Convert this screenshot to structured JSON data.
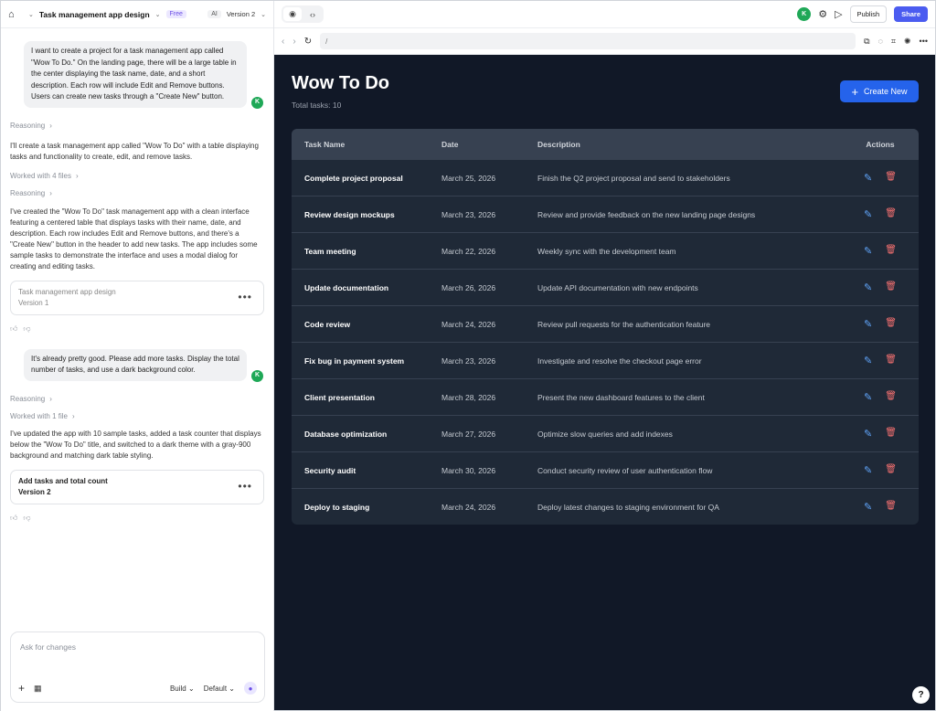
{
  "header": {
    "project_title": "Task management app design",
    "plan_badge": "Free",
    "ai_badge": "AI",
    "version": "Version 2"
  },
  "chat": {
    "messages": [
      {
        "role": "user",
        "text": "I want to create a project for a task management app called \"Wow To Do.\" On the landing page, there will be a large table in the center displaying the task name, date, and a short description. Each row will include Edit and Remove buttons. Users can create new tasks through a \"Create New\" button.",
        "avatar": "K"
      },
      {
        "role": "meta",
        "text": "Reasoning"
      },
      {
        "role": "assistant",
        "text": "I'll create a task management app called \"Wow To Do\" with a table displaying tasks and functionality to create, edit, and remove tasks."
      },
      {
        "role": "meta",
        "text": "Worked with 4 files"
      },
      {
        "role": "meta",
        "text": "Reasoning"
      },
      {
        "role": "assistant",
        "text": "I've created the \"Wow To Do\" task management app with a clean interface featuring a centered table that displays tasks with their name, date, and description. Each row includes Edit and Remove buttons, and there's a \"Create New\" button in the header to add new tasks. The app includes some sample tasks to demonstrate the interface and uses a modal dialog for creating and editing tasks."
      },
      {
        "role": "card",
        "title": "Task management app design",
        "version": "Version 1"
      },
      {
        "role": "user",
        "text": "It's already pretty good. Please add more tasks. Display the total number of tasks, and use a dark background color.",
        "avatar": "K"
      },
      {
        "role": "meta",
        "text": "Reasoning"
      },
      {
        "role": "meta",
        "text": "Worked with 1 file"
      },
      {
        "role": "assistant",
        "text": "I've updated the app with 10 sample tasks, added a task counter that displays below the \"Wow To Do\" title, and switched to a dark theme with a gray-900 background and matching dark table styling."
      },
      {
        "role": "card",
        "title": "Add tasks and total count",
        "version": "Version 2"
      }
    ],
    "input_placeholder": "Ask for changes",
    "mode_build": "Build",
    "mode_default": "Default"
  },
  "topbar": {
    "avatar": "K",
    "publish": "Publish",
    "share": "Share"
  },
  "address": {
    "url": "/"
  },
  "app": {
    "title": "Wow To Do",
    "total_label": "Total tasks: 10",
    "create_button": "Create New",
    "columns": [
      "Task Name",
      "Date",
      "Description",
      "Actions"
    ],
    "tasks": [
      {
        "name": "Complete project proposal",
        "date": "March 25, 2026",
        "desc": "Finish the Q2 project proposal and send to stakeholders"
      },
      {
        "name": "Review design mockups",
        "date": "March 23, 2026",
        "desc": "Review and provide feedback on the new landing page designs"
      },
      {
        "name": "Team meeting",
        "date": "March 22, 2026",
        "desc": "Weekly sync with the development team"
      },
      {
        "name": "Update documentation",
        "date": "March 26, 2026",
        "desc": "Update API documentation with new endpoints"
      },
      {
        "name": "Code review",
        "date": "March 24, 2026",
        "desc": "Review pull requests for the authentication feature"
      },
      {
        "name": "Fix bug in payment system",
        "date": "March 23, 2026",
        "desc": "Investigate and resolve the checkout page error"
      },
      {
        "name": "Client presentation",
        "date": "March 28, 2026",
        "desc": "Present the new dashboard features to the client"
      },
      {
        "name": "Database optimization",
        "date": "March 27, 2026",
        "desc": "Optimize slow queries and add indexes"
      },
      {
        "name": "Security audit",
        "date": "March 30, 2026",
        "desc": "Conduct security review of user authentication flow"
      },
      {
        "name": "Deploy to staging",
        "date": "March 24, 2026",
        "desc": "Deploy latest changes to staging environment for QA"
      }
    ]
  },
  "help": "?"
}
